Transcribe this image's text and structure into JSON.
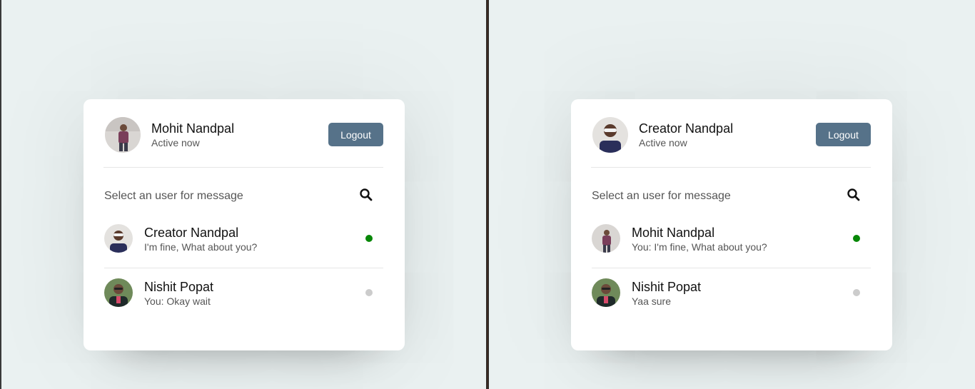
{
  "panes": [
    {
      "user": {
        "name": "Mohit Nandpal",
        "status": "Active now"
      },
      "logout_label": "Logout",
      "search_placeholder": "Select an user for message",
      "contacts": [
        {
          "name": "Creator Nandpal",
          "message": "I'm fine, What about you?",
          "status": "online"
        },
        {
          "name": "Nishit Popat",
          "message": "You: Okay wait",
          "status": "offline"
        }
      ]
    },
    {
      "user": {
        "name": "Creator Nandpal",
        "status": "Active now"
      },
      "logout_label": "Logout",
      "search_placeholder": "Select an user for message",
      "contacts": [
        {
          "name": "Mohit Nandpal",
          "message": "You: I'm fine, What about you?",
          "status": "online"
        },
        {
          "name": "Nishit Popat",
          "message": "Yaa sure",
          "status": "offline"
        }
      ]
    }
  ],
  "colors": {
    "background": "#eaf1f1",
    "logout_button": "#567289",
    "online": "#078707",
    "offline": "#cccccc"
  },
  "icons": {
    "search": "search-icon"
  }
}
